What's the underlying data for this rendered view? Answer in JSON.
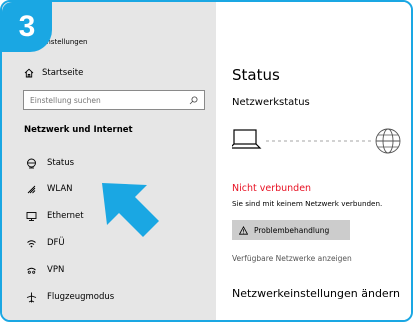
{
  "badge": {
    "number": "3"
  },
  "window": {
    "title": "Einstellungen"
  },
  "sidebar": {
    "home_label": "Startseite",
    "search_placeholder": "Einstellung suchen",
    "section_header": "Netzwerk und Internet",
    "items": [
      {
        "label": "Status",
        "icon": "status-icon"
      },
      {
        "label": "WLAN",
        "icon": "wifi-icon"
      },
      {
        "label": "Ethernet",
        "icon": "ethernet-icon"
      },
      {
        "label": "DFÜ",
        "icon": "dialup-icon"
      },
      {
        "label": "VPN",
        "icon": "vpn-icon"
      },
      {
        "label": "Flugzeugmodus",
        "icon": "airplane-icon"
      }
    ]
  },
  "main": {
    "title": "Status",
    "subtitle": "Netzwerkstatus",
    "disconnected_label": "Nicht verbunden",
    "disconnected_detail": "Sie sind mit keinem Netzwerk verbunden.",
    "troubleshoot_label": "Problembehandlung",
    "available_networks_link": "Verfügbare Netzwerke anzeigen",
    "change_settings_heading": "Netzwerkeinstellungen ändern"
  },
  "colors": {
    "accent": "#1aa7e3",
    "error": "#e81123",
    "sidebar_bg": "#e6e6e6"
  }
}
